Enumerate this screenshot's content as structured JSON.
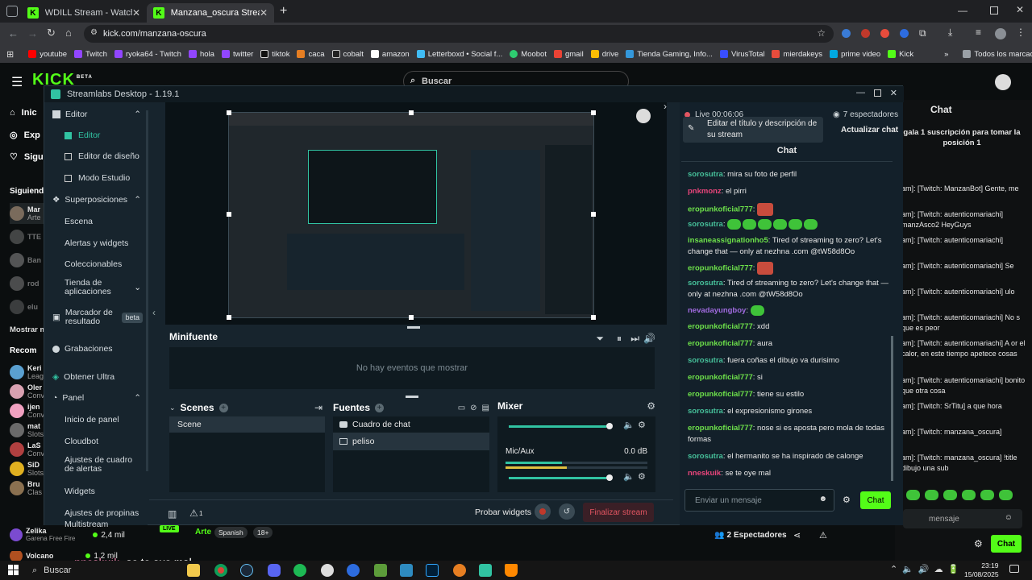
{
  "browser": {
    "tabs": [
      {
        "title": "WDILL Stream - Watch Live on K",
        "active": false
      },
      {
        "title": "Manzana_oscura Stream - Watc",
        "active": true
      }
    ],
    "url": "kick.com/manzana-oscura",
    "bookmarks": [
      "youtube",
      "Twitch",
      "ryoka64 - Twitch",
      "hola",
      "twitter",
      "tiktok",
      "caca",
      "cobalt",
      "amazon",
      "Letterboxd • Social f...",
      "Moobot",
      "gmail",
      "drive",
      "Tienda Gaming, Info...",
      "VirusTotal",
      "mierdakeys",
      "prime video",
      "Kick"
    ],
    "bookmarks_more": "»",
    "all_bookmarks": "Todos los marcadores"
  },
  "kick": {
    "logo": "KICK",
    "logo_tag": "BETA",
    "search_placeholder": "Buscar",
    "nav": [
      "Inic",
      "Exp",
      "Sigu"
    ],
    "following_header": "Siguiend",
    "follow_items": [
      {
        "name": "Mar",
        "sub": "Arte"
      },
      {
        "name": "TTE",
        "sub": ""
      },
      {
        "name": "Ban",
        "sub": ""
      },
      {
        "name": "rod",
        "sub": ""
      },
      {
        "name": "elu",
        "sub": ""
      }
    ],
    "show_more": "Mostrar m",
    "recommended_header": "Recom",
    "recommended": [
      {
        "name": "Keri",
        "sub": "Leag"
      },
      {
        "name": "Oler",
        "sub": "Conv"
      },
      {
        "name": "ijen",
        "sub": "Conv"
      },
      {
        "name": "mat",
        "sub": "Slots"
      },
      {
        "name": "LaS",
        "sub": "Conv"
      },
      {
        "name": "SiD",
        "sub": "Slots"
      },
      {
        "name": "Bru",
        "sub": "Clas"
      }
    ],
    "bottom_streams": [
      {
        "name": "Zelika",
        "sub": "Garena Free Fire",
        "viewers": "2,4 mil"
      },
      {
        "name": "Volcano",
        "sub": "",
        "viewers": "1,2 mil"
      }
    ],
    "stream_meta": {
      "live": "LIVE",
      "category": "Arte",
      "tags": [
        "Spanish",
        "18+"
      ]
    },
    "viewers_bar": {
      "count": "2",
      "label": "Espectadores"
    },
    "right_chat": {
      "title": "Chat",
      "pinned": "gala 1 suscripción para tomar la posición 1",
      "messages": [
        "am]: [Twitch: ManzanBot] Gente, me",
        "am]: [Twitch: autenticomariachi] manzAsco2 HeyGuys",
        "am]: [Twitch: autenticomariachi]",
        "am]: [Twitch: autenticomariachi] Se",
        "am]: [Twitch: autenticomariachi] ulo",
        "am]: [Twitch: autenticomariachi] No s que es peor",
        "am]: [Twitch: autenticomariachi] A or el calor, en este tiempo apetece cosas",
        "am]: [Twitch: autenticomariachi] bonito que otra cosa",
        "am]: [Twitch: SrTitu] a que hora",
        "am]: [Twitch: manzana_oscura]",
        "am]: [Twitch: manzana_oscura] !title dibujo una sub"
      ],
      "input_placeholder": "mensaje",
      "send": "Chat"
    }
  },
  "streamlabs": {
    "title": "Streamlabs Desktop - 1.19.1",
    "sidebar": [
      {
        "label": "Editor",
        "type": "header"
      },
      {
        "label": "Editor",
        "type": "sub",
        "active": true
      },
      {
        "label": "Editor de diseño",
        "type": "sub"
      },
      {
        "label": "Modo Estudio",
        "type": "sub"
      },
      {
        "label": "Superposiciones",
        "type": "header"
      },
      {
        "label": "Escena",
        "type": "sub"
      },
      {
        "label": "Alertas y widgets",
        "type": "sub"
      },
      {
        "label": "Coleccionables",
        "type": "sub"
      },
      {
        "label": "Tienda de aplicaciones",
        "type": "header"
      },
      {
        "label": "Marcador de resultado",
        "type": "header",
        "badge": "beta"
      },
      {
        "label": "Grabaciones",
        "type": "header"
      },
      {
        "label": "Obtener Ultra",
        "type": "header"
      },
      {
        "label": "Panel",
        "type": "header"
      },
      {
        "label": "Inicio de panel",
        "type": "sub"
      },
      {
        "label": "Cloudbot",
        "type": "sub"
      },
      {
        "label": "Ajustes de cuadro de alertas",
        "type": "sub"
      },
      {
        "label": "Widgets",
        "type": "sub"
      },
      {
        "label": "Ajustes de propinas",
        "type": "sub"
      },
      {
        "label": "Multistream",
        "type": "sub"
      }
    ],
    "minifeed": {
      "title": "Minifuente",
      "empty": "No hay eventos que mostrar"
    },
    "scenes": {
      "title": "Scenes",
      "items": [
        "Scene"
      ]
    },
    "sources": {
      "title": "Fuentes",
      "items": [
        "Cuadro de chat",
        "peliso"
      ]
    },
    "mixer": {
      "title": "Mixer",
      "channel": "Mic/Aux",
      "db": "0.0 dB",
      "desktop_level": 0.96,
      "mic_level": 0.96
    },
    "footer": {
      "test_widgets": "Probar widgets",
      "end_stream": "Finalizar stream",
      "alerts_count": "1"
    },
    "live": {
      "status": "Live 00:06:06",
      "viewers": "7 espectadores",
      "edit_title": "Editar el título y descripción de su stream",
      "update_chat": "Actualizar chat"
    },
    "chat": {
      "title": "Chat",
      "messages": [
        {
          "user": "sorosutra",
          "text": ": mira su foto de perfil",
          "color": "u3"
        },
        {
          "user": "pnkmonz",
          "text": ": el pirri",
          "color": "u2"
        },
        {
          "user": "eropunkoficial777",
          "text": ":",
          "color": "u1",
          "emote": "red"
        },
        {
          "user": "sorosutra",
          "text": ":",
          "color": "u3",
          "emote": "green6"
        },
        {
          "user": "insaneassignationho5",
          "text": ": Tired of streaming to zero? Let's change that — only at nezhna .com @tW58d8Oo",
          "color": "u1"
        },
        {
          "user": "eropunkoficial777",
          "text": ":",
          "color": "u1",
          "emote": "red"
        },
        {
          "user": "sorosutra",
          "text": ": Tired of streaming to zero? Let's change that — only at nezhna .com @tW58d8Oo",
          "color": "u3"
        },
        {
          "user": "nevadayungboy",
          "text": ":",
          "color": "u4",
          "emote": "green1"
        },
        {
          "user": "eropunkoficial777",
          "text": ": xdd",
          "color": "u1"
        },
        {
          "user": "eropunkoficial777",
          "text": ": aura",
          "color": "u1"
        },
        {
          "user": "sorosutra",
          "text": ": fuera coñas el dibujo va durisimo",
          "color": "u3"
        },
        {
          "user": "eropunkoficial777",
          "text": ": si",
          "color": "u1"
        },
        {
          "user": "eropunkoficial777",
          "text": ": tiene su estilo",
          "color": "u1"
        },
        {
          "user": "sorosutra",
          "text": ": el expresionismo girones",
          "color": "u3"
        },
        {
          "user": "eropunkoficial777",
          "text": ": nose si es aposta pero mola de todas formas",
          "color": "u1"
        },
        {
          "user": "sorosutra",
          "text": ": el hermanito se ha inspirado de calonge",
          "color": "u3"
        },
        {
          "user": "nneskuik",
          "text": ": se te oye mal",
          "color": "u2"
        }
      ],
      "input_placeholder": "Enviar un mensaje",
      "send": "Chat"
    }
  },
  "overlay_caption": {
    "user": "nneskuik",
    "text": "se te oye mal"
  },
  "taskbar": {
    "search": "Buscar",
    "time": "23:19",
    "date": "15/08/2025"
  }
}
